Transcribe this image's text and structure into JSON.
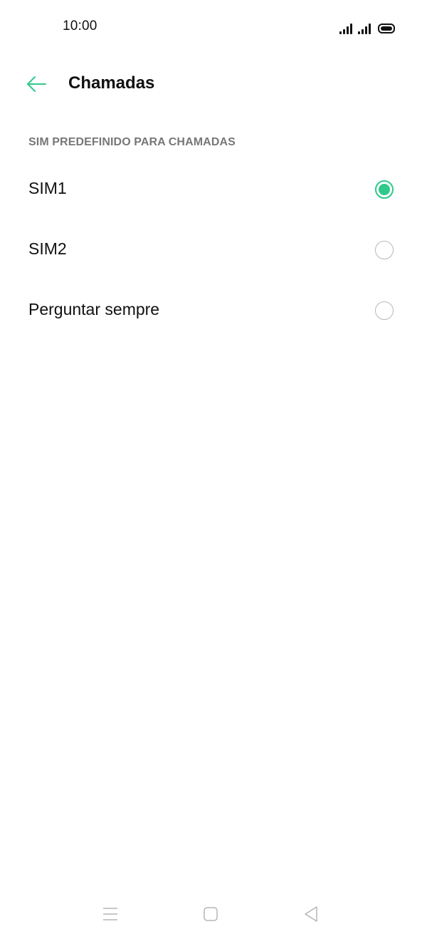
{
  "status_bar": {
    "time": "10:00",
    "icons": [
      "signal-sim1-icon",
      "signal-sim2-icon",
      "battery-icon"
    ]
  },
  "header": {
    "back_icon": "arrow-left-icon",
    "title": "Chamadas"
  },
  "section": {
    "title": "SIM PREDEFINIDO PARA CHAMADAS",
    "options": [
      {
        "label": "SIM1",
        "selected": true
      },
      {
        "label": "SIM2",
        "selected": false
      },
      {
        "label": "Perguntar sempre",
        "selected": false
      }
    ]
  },
  "nav_bar": {
    "icons": [
      "menu-icon",
      "home-icon",
      "back-triangle-icon"
    ]
  },
  "colors": {
    "accent": "#2fc98a",
    "section_header": "#777777",
    "text": "#111111",
    "radio_border": "#b8b8b8"
  }
}
